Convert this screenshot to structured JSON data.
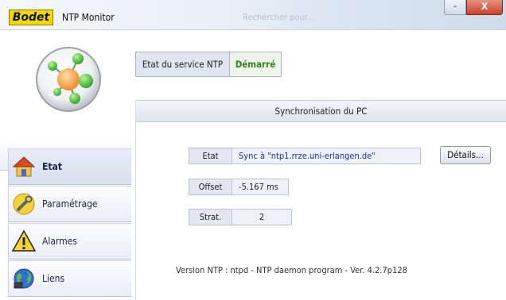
{
  "window": {
    "brand": "Bodet",
    "title": "NTP Monitor",
    "ghost_text": "Rechercher pour...",
    "minimize_glyph": "–",
    "close_glyph": "X"
  },
  "service": {
    "label": "Etat du service NTP",
    "value": "Démarré"
  },
  "sidebar": {
    "items": [
      {
        "label": "Etat",
        "icon": "home-icon",
        "active": true
      },
      {
        "label": "Paramétrage",
        "icon": "wrench-icon",
        "active": false
      },
      {
        "label": "Alarmes",
        "icon": "warning-icon",
        "active": false
      },
      {
        "label": "Liens",
        "icon": "globe-icon",
        "active": false
      }
    ]
  },
  "sync": {
    "header": "Synchronisation du PC",
    "etat": {
      "label": "Etat",
      "value": "Sync à \"ntp1.rrze.uni-erlangen.de\""
    },
    "offset": {
      "label": "Offset",
      "value": "-5.167 ms"
    },
    "strat": {
      "label": "Strat.",
      "value": "2"
    },
    "details_button": "Détails...",
    "version": "Version NTP :  ntpd - NTP daemon program - Ver. 4.2.7p128"
  },
  "colors": {
    "brand_yellow": "#f2d900",
    "status_green": "#2f7f1f",
    "link_blue": "#1a2fb8"
  }
}
